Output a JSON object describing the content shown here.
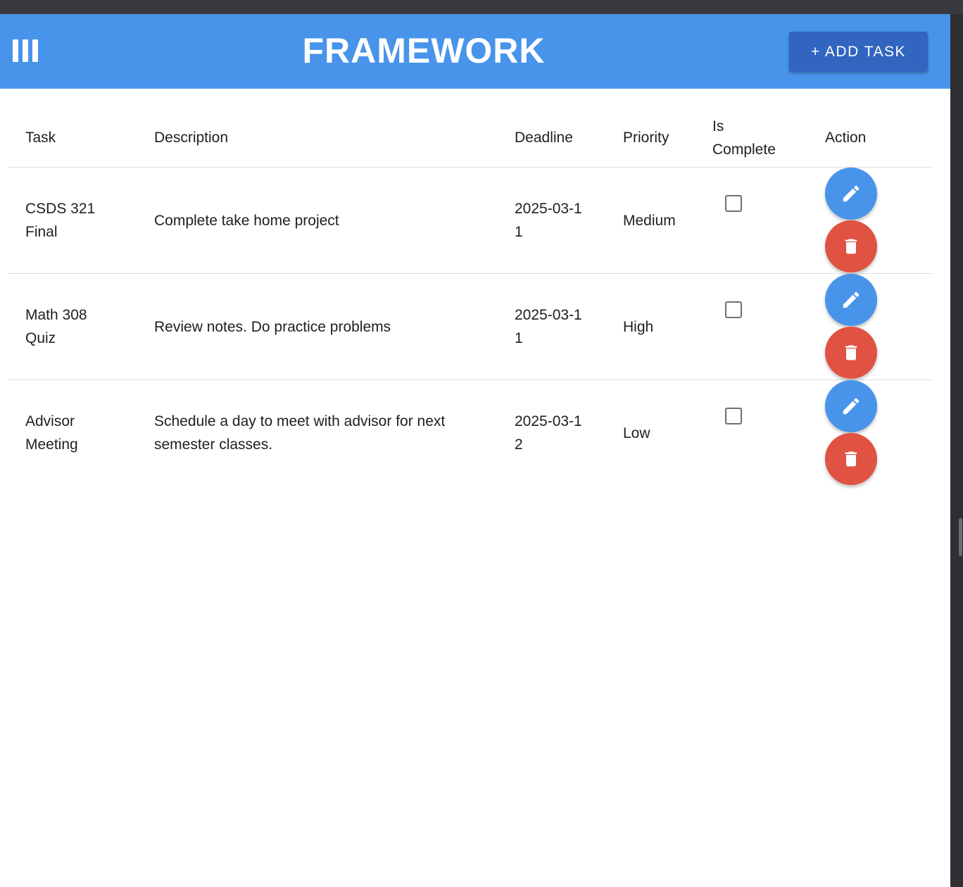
{
  "header": {
    "title": "FRAMEWORK",
    "add_button_label": "+ ADD TASK",
    "color": "#4894ea",
    "button_color": "#3165c0"
  },
  "table": {
    "columns": [
      "Task",
      "Description",
      "Deadline",
      "Priority",
      "Is Complete",
      "Action"
    ],
    "rows": [
      {
        "task": "CSDS 321 Final",
        "description": "Complete take home project",
        "deadline": "2025-03-11",
        "priority": "Medium",
        "is_complete": false
      },
      {
        "task": "Math 308 Quiz",
        "description": "Review notes. Do practice problems",
        "deadline": "2025-03-11",
        "priority": "High",
        "is_complete": false
      },
      {
        "task": "Advisor Meeting",
        "description": "Schedule a day to meet with advisor for next semester classes.",
        "deadline": "2025-03-12",
        "priority": "Low",
        "is_complete": false
      }
    ]
  },
  "icons": {
    "menu": "view-column-icon",
    "edit": "pencil-icon",
    "delete": "trash-icon"
  },
  "colors": {
    "edit_fab": "#4894ea",
    "delete_fab": "#e05241"
  }
}
